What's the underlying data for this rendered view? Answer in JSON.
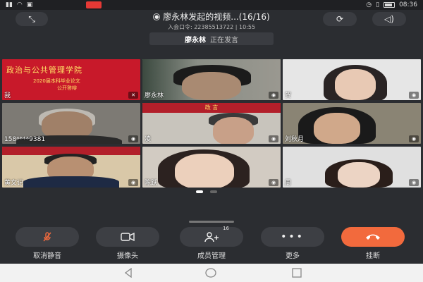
{
  "status_bar": {
    "carrier": "",
    "clock": "08:36"
  },
  "meeting": {
    "title": "廖永林发起的视频...(16/16)",
    "subtitle": "入会口令: 22385513722 | 10:55"
  },
  "speaker": {
    "name": "廖永林",
    "status": "正在发言"
  },
  "tiles": [
    {
      "label": "我",
      "banner_line1": "政治与公共管理学院",
      "banner_line2": "2020届本科毕业论文",
      "banner_line3": "公开答辩"
    },
    {
      "label": "廖永林"
    },
    {
      "label": "贺"
    },
    {
      "label": "158****9381"
    },
    {
      "label": "凌",
      "top_text": "政 言"
    },
    {
      "label": "刘秋月"
    },
    {
      "label": "黄文记"
    },
    {
      "label": "陈跃"
    },
    {
      "label": "周"
    }
  ],
  "controls": [
    {
      "label": "取消静音",
      "icon": "mic-muted-icon"
    },
    {
      "label": "摄像头",
      "icon": "camera-icon"
    },
    {
      "label": "成员管理",
      "icon": "members-icon",
      "badge": "16"
    },
    {
      "label": "更多",
      "icon": "more-icon"
    },
    {
      "label": "挂断",
      "icon": "hangup-icon"
    }
  ],
  "colors": {
    "background": "#2b2d31",
    "active_speaker": "#3fd06a",
    "hangup": "#f26a3d",
    "banner": "#c8192a"
  }
}
